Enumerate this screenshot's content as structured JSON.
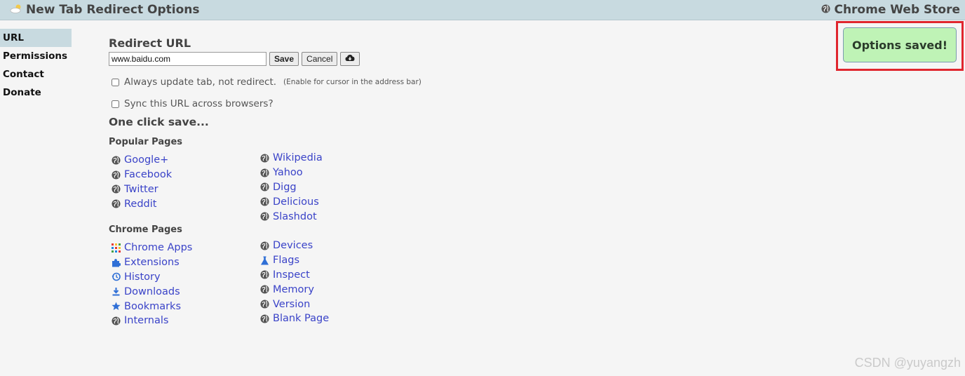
{
  "header": {
    "title": "New Tab Redirect Options",
    "store_link": "Chrome Web Store"
  },
  "sidebar": {
    "items": [
      {
        "label": "URL",
        "active": true
      },
      {
        "label": "Permissions"
      },
      {
        "label": "Contact"
      },
      {
        "label": "Donate"
      }
    ]
  },
  "redirect": {
    "heading": "Redirect URL",
    "url_value": "www.baidu.com",
    "save_label": "Save",
    "cancel_label": "Cancel"
  },
  "options": {
    "always_update_label": "Always update tab, not redirect.",
    "always_update_note": "(Enable for cursor in the address bar)",
    "always_update_checked": false,
    "sync_label": "Sync this URL across browsers?",
    "sync_checked": false
  },
  "one_click": {
    "heading": "One click save...",
    "popular_heading": "Popular Pages",
    "popular_left": [
      {
        "label": "Google+",
        "icon": "globe-icon"
      },
      {
        "label": "Facebook",
        "icon": "globe-icon"
      },
      {
        "label": "Twitter",
        "icon": "globe-icon"
      },
      {
        "label": "Reddit",
        "icon": "globe-icon"
      }
    ],
    "popular_right": [
      {
        "label": "Wikipedia",
        "icon": "globe-icon"
      },
      {
        "label": "Yahoo",
        "icon": "globe-icon"
      },
      {
        "label": "Digg",
        "icon": "globe-icon"
      },
      {
        "label": "Delicious",
        "icon": "globe-icon"
      },
      {
        "label": "Slashdot",
        "icon": "globe-icon"
      }
    ],
    "chrome_heading": "Chrome Pages",
    "chrome_left": [
      {
        "label": "Chrome Apps",
        "icon": "apps-grid-icon"
      },
      {
        "label": "Extensions",
        "icon": "puzzle-icon"
      },
      {
        "label": "History",
        "icon": "history-icon"
      },
      {
        "label": "Downloads",
        "icon": "download-icon"
      },
      {
        "label": "Bookmarks",
        "icon": "star-icon"
      },
      {
        "label": "Internals",
        "icon": "globe-icon"
      }
    ],
    "chrome_right": [
      {
        "label": "Devices",
        "icon": "globe-icon"
      },
      {
        "label": "Flags",
        "icon": "flask-icon"
      },
      {
        "label": "Inspect",
        "icon": "globe-icon"
      },
      {
        "label": "Memory",
        "icon": "globe-icon"
      },
      {
        "label": "Version",
        "icon": "globe-icon"
      },
      {
        "label": "Blank Page",
        "icon": "globe-icon"
      }
    ]
  },
  "notice": {
    "text": "Options saved!"
  },
  "watermark": "CSDN @yuyangzh"
}
